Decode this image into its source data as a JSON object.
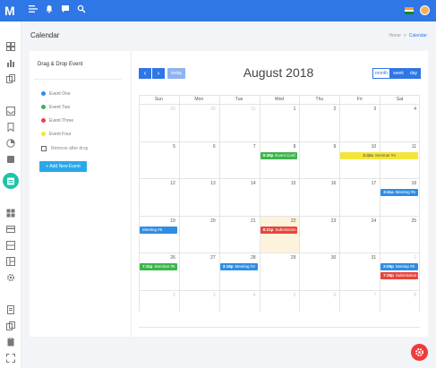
{
  "app": {
    "logo_letter": "M"
  },
  "topbar": {
    "icons": [
      "menu-icon",
      "bell-icon",
      "chat-icon",
      "search-icon"
    ],
    "flag_colors": [
      "#ff9933",
      "#ffffff",
      "#138808"
    ]
  },
  "sidebar": {
    "icons": [
      "dashboard-icon",
      "chart-icon",
      "copy-icon",
      "inbox-icon",
      "bookmark-icon",
      "pie-icon",
      "calendar-icon",
      "grid-icon",
      "card-icon",
      "layers-icon",
      "layout-icon",
      "settings-icon",
      "document-icon",
      "files-icon",
      "clipboard-icon",
      "expand-icon",
      "login-icon"
    ],
    "active": "calendar-icon"
  },
  "page": {
    "title": "Calendar",
    "breadcrumb": [
      "Home",
      "Calendar"
    ]
  },
  "events_panel": {
    "title": "Drag & Drop Event",
    "events": [
      {
        "label": "Event One",
        "color": "#2f8de4"
      },
      {
        "label": "Event Two",
        "color": "#3bb54a"
      },
      {
        "label": "Event Three",
        "color": "#e8453c"
      },
      {
        "label": "Event Four",
        "color": "#f3e53a"
      }
    ],
    "remove_after_drop": "Remove after drop",
    "add_button": "+ Add New Event"
  },
  "calendar": {
    "title": "August 2018",
    "today_button": "today",
    "prev_icon": "‹",
    "next_icon": "›",
    "views": {
      "month": "month",
      "week": "week",
      "day": "day",
      "selected": "month"
    },
    "days_of_week": [
      "Sun",
      "Mon",
      "Tue",
      "Wed",
      "Thu",
      "Fri",
      "Sat"
    ],
    "weeks": [
      [
        {
          "d": "29",
          "o": true
        },
        {
          "d": "30",
          "o": true
        },
        {
          "d": "31",
          "o": true
        },
        {
          "d": "1"
        },
        {
          "d": "2"
        },
        {
          "d": "3"
        },
        {
          "d": "4"
        }
      ],
      [
        {
          "d": "5"
        },
        {
          "d": "6"
        },
        {
          "d": "7"
        },
        {
          "d": "8"
        },
        {
          "d": "9"
        },
        {
          "d": "10"
        },
        {
          "d": "11"
        }
      ],
      [
        {
          "d": "12"
        },
        {
          "d": "13"
        },
        {
          "d": "14"
        },
        {
          "d": "15"
        },
        {
          "d": "16"
        },
        {
          "d": "17"
        },
        {
          "d": "18"
        }
      ],
      [
        {
          "d": "19"
        },
        {
          "d": "20"
        },
        {
          "d": "21"
        },
        {
          "d": "22"
        },
        {
          "d": "23"
        },
        {
          "d": "24"
        },
        {
          "d": "25"
        }
      ],
      [
        {
          "d": "26"
        },
        {
          "d": "27"
        },
        {
          "d": "28"
        },
        {
          "d": "29"
        },
        {
          "d": "30"
        },
        {
          "d": "31"
        },
        {
          "d": "1",
          "o": true
        }
      ],
      [
        {
          "d": "2",
          "o": true
        },
        {
          "d": "3",
          "o": true
        },
        {
          "d": "4",
          "o": true
        },
        {
          "d": "5",
          "o": true
        },
        {
          "d": "6",
          "o": true
        },
        {
          "d": "7",
          "o": true
        },
        {
          "d": "8",
          "o": true
        }
      ]
    ],
    "today_date": "22",
    "events": [
      {
        "time": "9:28p",
        "title": "Event Conf.",
        "color": "#3bb54a"
      },
      {
        "time": "2:42a",
        "title": "Seminar #4",
        "color": "#f3e53a"
      },
      {
        "time": "3:41a",
        "title": "Meeting #5",
        "color": "#2f8de4"
      },
      {
        "time": "",
        "title": "Meeting #5",
        "color": "#2f8de4"
      },
      {
        "time": "8:21p",
        "title": "Submission #1",
        "color": "#e8453c"
      },
      {
        "time": "7:11p",
        "title": "Seminar #5",
        "color": "#3bb54a"
      },
      {
        "time": "3:18p",
        "title": "Meeting #3",
        "color": "#2f8de4"
      },
      {
        "time": "2:05p",
        "title": "Meetup #5",
        "color": "#2f8de4"
      },
      {
        "time": "7:28p",
        "title": "Submission #2",
        "color": "#e8453c"
      }
    ]
  },
  "fab": {
    "icon": "settings-icon"
  }
}
